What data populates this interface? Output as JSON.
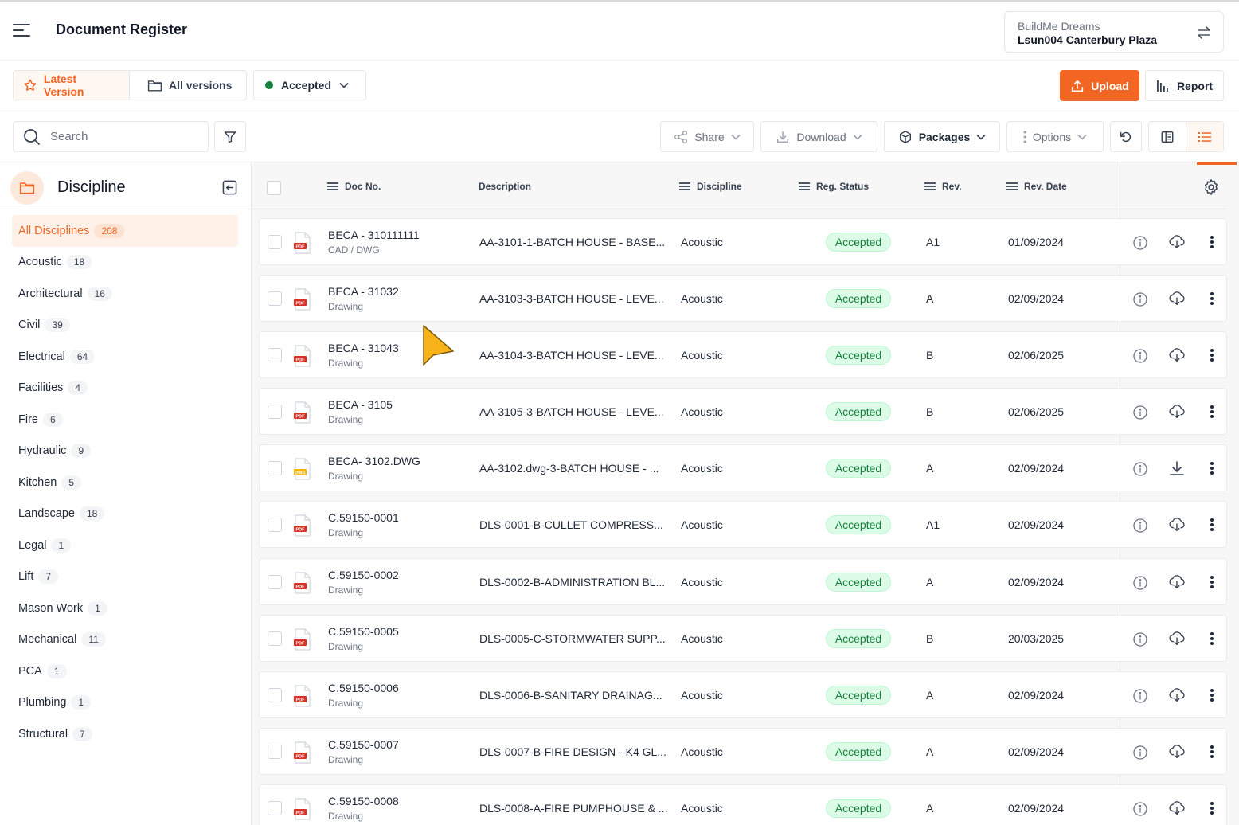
{
  "header": {
    "title": "Document Register",
    "org": "BuildMe Dreams",
    "project": "Lsun004 Canterbury Plaza"
  },
  "toolbar": {
    "latest_version": "Latest Version",
    "all_versions": "All versions",
    "status_filter": "Accepted",
    "upload": "Upload",
    "report": "Report",
    "search_placeholder": "Search",
    "share": "Share",
    "download": "Download",
    "packages": "Packages",
    "options": "Options"
  },
  "sidebar": {
    "title": "Discipline",
    "items": [
      {
        "label": "All Disciplines",
        "count": "208"
      },
      {
        "label": "Acoustic",
        "count": "18"
      },
      {
        "label": "Architectural",
        "count": "16"
      },
      {
        "label": "Civil",
        "count": "39"
      },
      {
        "label": "Electrical",
        "count": "64"
      },
      {
        "label": "Facilities",
        "count": "4"
      },
      {
        "label": "Fire",
        "count": "6"
      },
      {
        "label": "Hydraulic",
        "count": "9"
      },
      {
        "label": "Kitchen",
        "count": "5"
      },
      {
        "label": "Landscape",
        "count": "18"
      },
      {
        "label": "Legal",
        "count": "1"
      },
      {
        "label": "Lift",
        "count": "7"
      },
      {
        "label": "Mason Work",
        "count": "1"
      },
      {
        "label": "Mechanical",
        "count": "11"
      },
      {
        "label": "PCA",
        "count": "1"
      },
      {
        "label": "Plumbing",
        "count": "1"
      },
      {
        "label": "Structural",
        "count": "7"
      }
    ]
  },
  "table": {
    "columns": {
      "doc_no": "Doc No.",
      "description": "Description",
      "discipline": "Discipline",
      "reg_status": "Reg. Status",
      "rev": "Rev.",
      "rev_date": "Rev. Date"
    },
    "rows": [
      {
        "doc_no": "BECA - 310111111",
        "type": "CAD / DWG",
        "file_badge": "PDF",
        "description": "AA-3101-1-BATCH HOUSE - BASE...",
        "discipline": "Acoustic",
        "status": "Accepted",
        "rev": "A1",
        "rev_date": "01/09/2024",
        "dl_icon": "cloud-download-icon"
      },
      {
        "doc_no": "BECA - 31032",
        "type": "Drawing",
        "file_badge": "PDF",
        "description": "AA-3103-3-BATCH HOUSE - LEVE...",
        "discipline": "Acoustic",
        "status": "Accepted",
        "rev": "A",
        "rev_date": "02/09/2024",
        "dl_icon": "cloud-download-icon"
      },
      {
        "doc_no": "BECA - 31043",
        "type": "Drawing",
        "file_badge": "PDF",
        "description": "AA-3104-3-BATCH HOUSE - LEVE...",
        "discipline": "Acoustic",
        "status": "Accepted",
        "rev": "B",
        "rev_date": "02/06/2025",
        "dl_icon": "cloud-download-icon"
      },
      {
        "doc_no": "BECA - 3105",
        "type": "Drawing",
        "file_badge": "PDF",
        "description": "AA-3105-3-BATCH HOUSE - LEVE...",
        "discipline": "Acoustic",
        "status": "Accepted",
        "rev": "B",
        "rev_date": "02/06/2025",
        "dl_icon": "cloud-download-icon"
      },
      {
        "doc_no": "BECA- 3102.DWG",
        "type": "Drawing",
        "file_badge": "DWG",
        "description": "AA-3102.dwg-3-BATCH HOUSE - ...",
        "discipline": "Acoustic",
        "status": "Accepted",
        "rev": "A",
        "rev_date": "02/09/2024",
        "dl_icon": "download-icon"
      },
      {
        "doc_no": "C.59150-0001",
        "type": "Drawing",
        "file_badge": "PDF",
        "description": "DLS-0001-B-CULLET COMPRESS...",
        "discipline": "Acoustic",
        "status": "Accepted",
        "rev": "A1",
        "rev_date": "02/09/2024",
        "dl_icon": "cloud-download-icon"
      },
      {
        "doc_no": "C.59150-0002",
        "type": "Drawing",
        "file_badge": "PDF",
        "description": "DLS-0002-B-ADMINISTRATION BL...",
        "discipline": "Acoustic",
        "status": "Accepted",
        "rev": "A",
        "rev_date": "02/09/2024",
        "dl_icon": "cloud-download-icon"
      },
      {
        "doc_no": "C.59150-0005",
        "type": "Drawing",
        "file_badge": "PDF",
        "description": "DLS-0005-C-STORMWATER SUPP...",
        "discipline": "Acoustic",
        "status": "Accepted",
        "rev": "B",
        "rev_date": "20/03/2025",
        "dl_icon": "cloud-download-icon"
      },
      {
        "doc_no": "C.59150-0006",
        "type": "Drawing",
        "file_badge": "PDF",
        "description": "DLS-0006-B-SANITARY DRAINAG...",
        "discipline": "Acoustic",
        "status": "Accepted",
        "rev": "A",
        "rev_date": "02/09/2024",
        "dl_icon": "cloud-download-icon"
      },
      {
        "doc_no": "C.59150-0007",
        "type": "Drawing",
        "file_badge": "PDF",
        "description": "DLS-0007-B-FIRE DESIGN - K4 GL...",
        "discipline": "Acoustic",
        "status": "Accepted",
        "rev": "A",
        "rev_date": "02/09/2024",
        "dl_icon": "cloud-download-icon"
      },
      {
        "doc_no": "C.59150-0008",
        "type": "Drawing",
        "file_badge": "PDF",
        "description": "DLS-0008-A-FIRE PUMPHOUSE & ...",
        "discipline": "Acoustic",
        "status": "Accepted",
        "rev": "A",
        "rev_date": "02/09/2024",
        "dl_icon": "cloud-download-icon"
      }
    ]
  },
  "colors": {
    "accent": "#f26522",
    "status_green": "#15803d",
    "status_bg": "#dcfce7"
  }
}
